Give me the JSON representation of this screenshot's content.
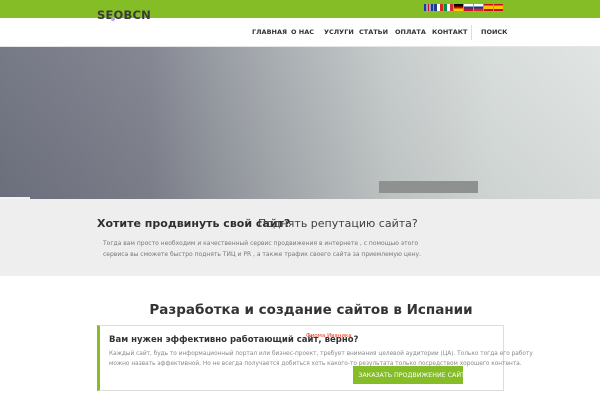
{
  "topbar": {
    "color": "#84bd26",
    "flags": [
      "flag-uk-icon",
      "flag-fr-icon",
      "flag-it-icon",
      "flag-de-icon",
      "flag-br-icon",
      "flag-ru-icon",
      "flag-es-icon",
      "flag-ru2-icon"
    ]
  },
  "header": {
    "logo": "SEOBCN",
    "nav": [
      "ГЛАВНАЯ",
      "О НАС",
      "УСЛУГИ",
      "СТАТЬИ",
      "ОПЛАТА",
      "КОНТАКТ"
    ],
    "search": "ПОИСК"
  },
  "promo": {
    "title_bold": "Хотите продвинуть свой сайт?",
    "title_rest": "Поднять репутацию сайта?",
    "text": "Тогда вам просто необходим и качественный сервис продвижения в интернете , с помощью этого сервиса вы сможете быстро поднять ТИЦ и PR , а также трафик своего сайта за приемлемую цену."
  },
  "section": {
    "title": "Разработка и создание сайтов в Испании"
  },
  "cta": {
    "title": "Вам нужен эффективно работающий сайт, верно?",
    "red_label": "Фирма Иваника",
    "text": "Каждый сайт, будь то информационный портал или бизнес-проект, требует внимания целевой аудитории (ЦА). Только тогда его работу можно назвать эффективной. Но не всегда получается добиться хоть какого-то результата только посредством хорошего контента.",
    "button": "ЗАКАЗАТЬ ПРОДВИЖЕНИЕ САЙТА",
    "accent": "#84bd26"
  }
}
